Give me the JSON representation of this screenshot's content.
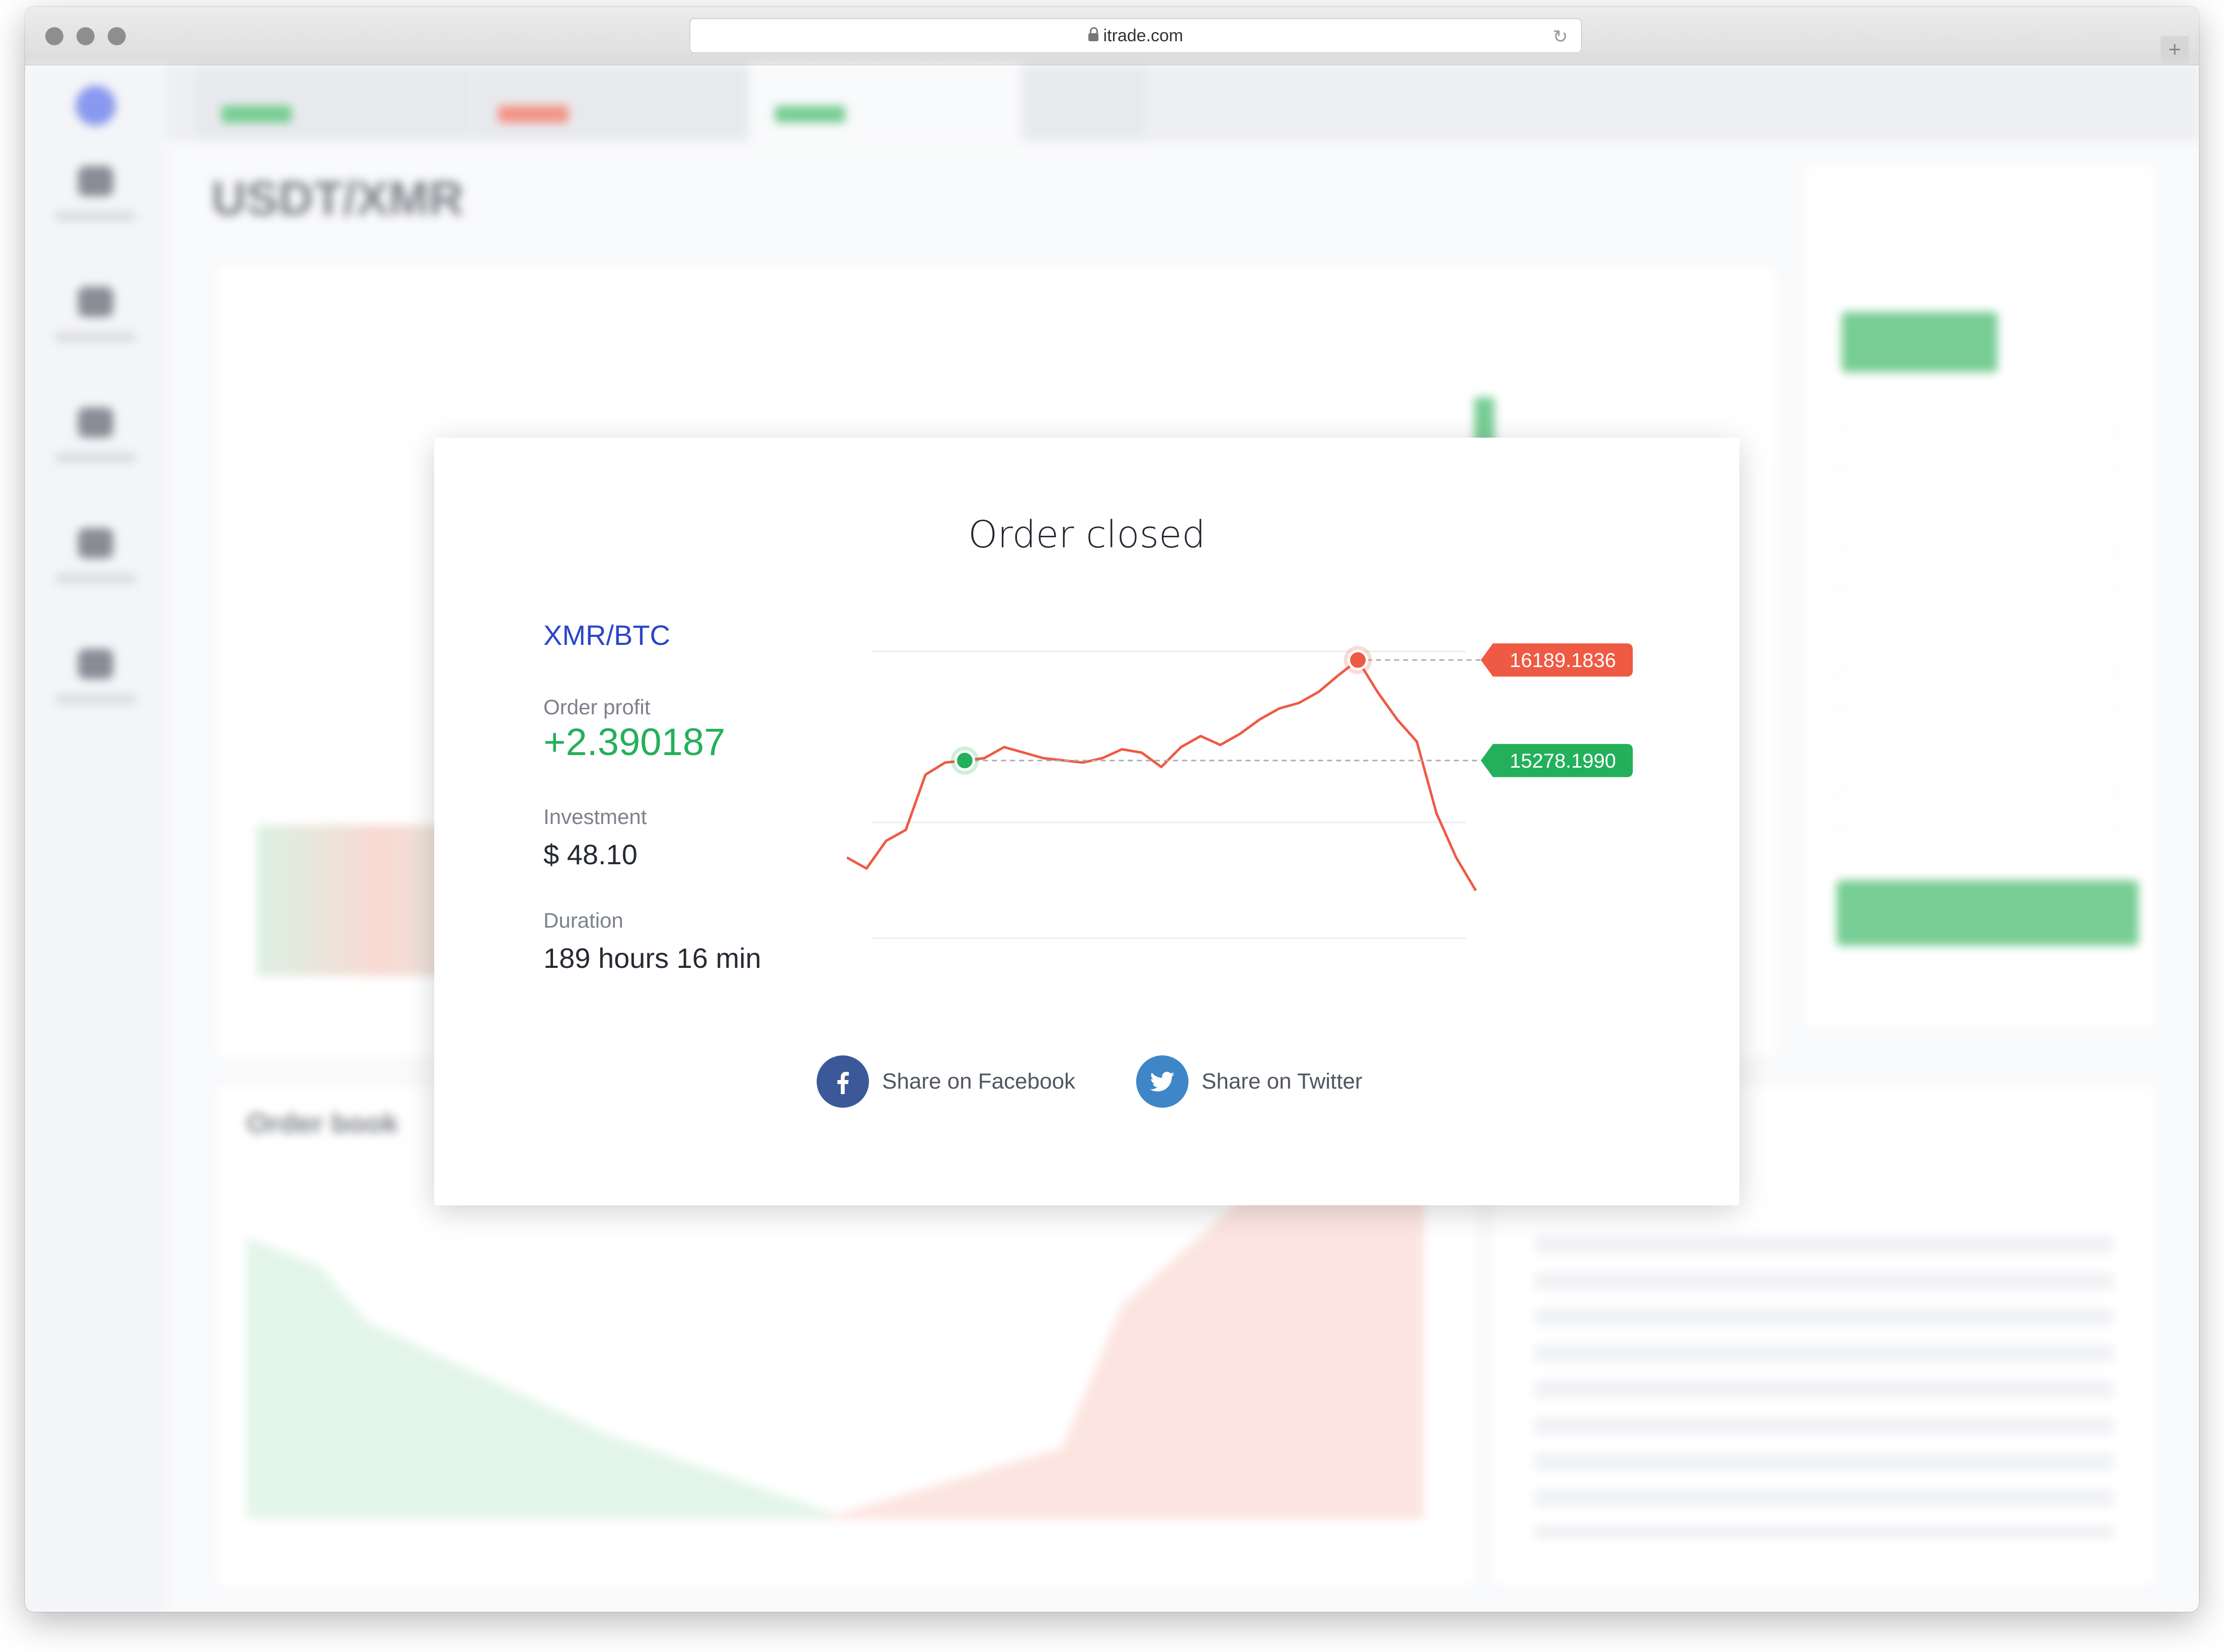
{
  "browser": {
    "url": "itrade.com"
  },
  "background_app": {
    "pair_title": "USDT/XMR",
    "panel_title": "Order book"
  },
  "modal": {
    "title": "Order closed",
    "pair": "XMR/BTC",
    "order_profit_label": "Order profit",
    "order_profit_value": "+2.390187",
    "investment_label": "Investment",
    "investment_value": "$ 48.10",
    "duration_label": "Duration",
    "duration_value": "189 hours 16 min",
    "share_facebook": "Share on Facebook",
    "share_twitter": "Share on Twitter"
  },
  "chart_data": {
    "type": "line",
    "title": "",
    "series": [
      {
        "values": [
          14400,
          14300,
          14550,
          14650,
          15150,
          15260,
          15278.199,
          15300,
          15400,
          15350,
          15300,
          15280,
          15260,
          15300,
          15380,
          15350,
          15220,
          15400,
          15500,
          15420,
          15520,
          15650,
          15750,
          15800,
          15900,
          16050,
          16189.1836,
          15900,
          15650,
          15450,
          14800,
          14400,
          14100
        ]
      }
    ],
    "entry_value": 15278.199,
    "entry_label": "15278.1990",
    "exit_value": 16189.1836,
    "exit_label": "16189.1836",
    "colors": {
      "line": "#ef5a44",
      "entry": "#24b05b",
      "exit": "#ef5a44"
    }
  },
  "colors": {
    "facebook": "#3b5998",
    "twitter": "#3e86c7",
    "profit": "#24b05b",
    "pair": "#2b45c8"
  },
  "icons": {
    "facebook": "facebook-icon",
    "twitter": "twitter-icon"
  }
}
